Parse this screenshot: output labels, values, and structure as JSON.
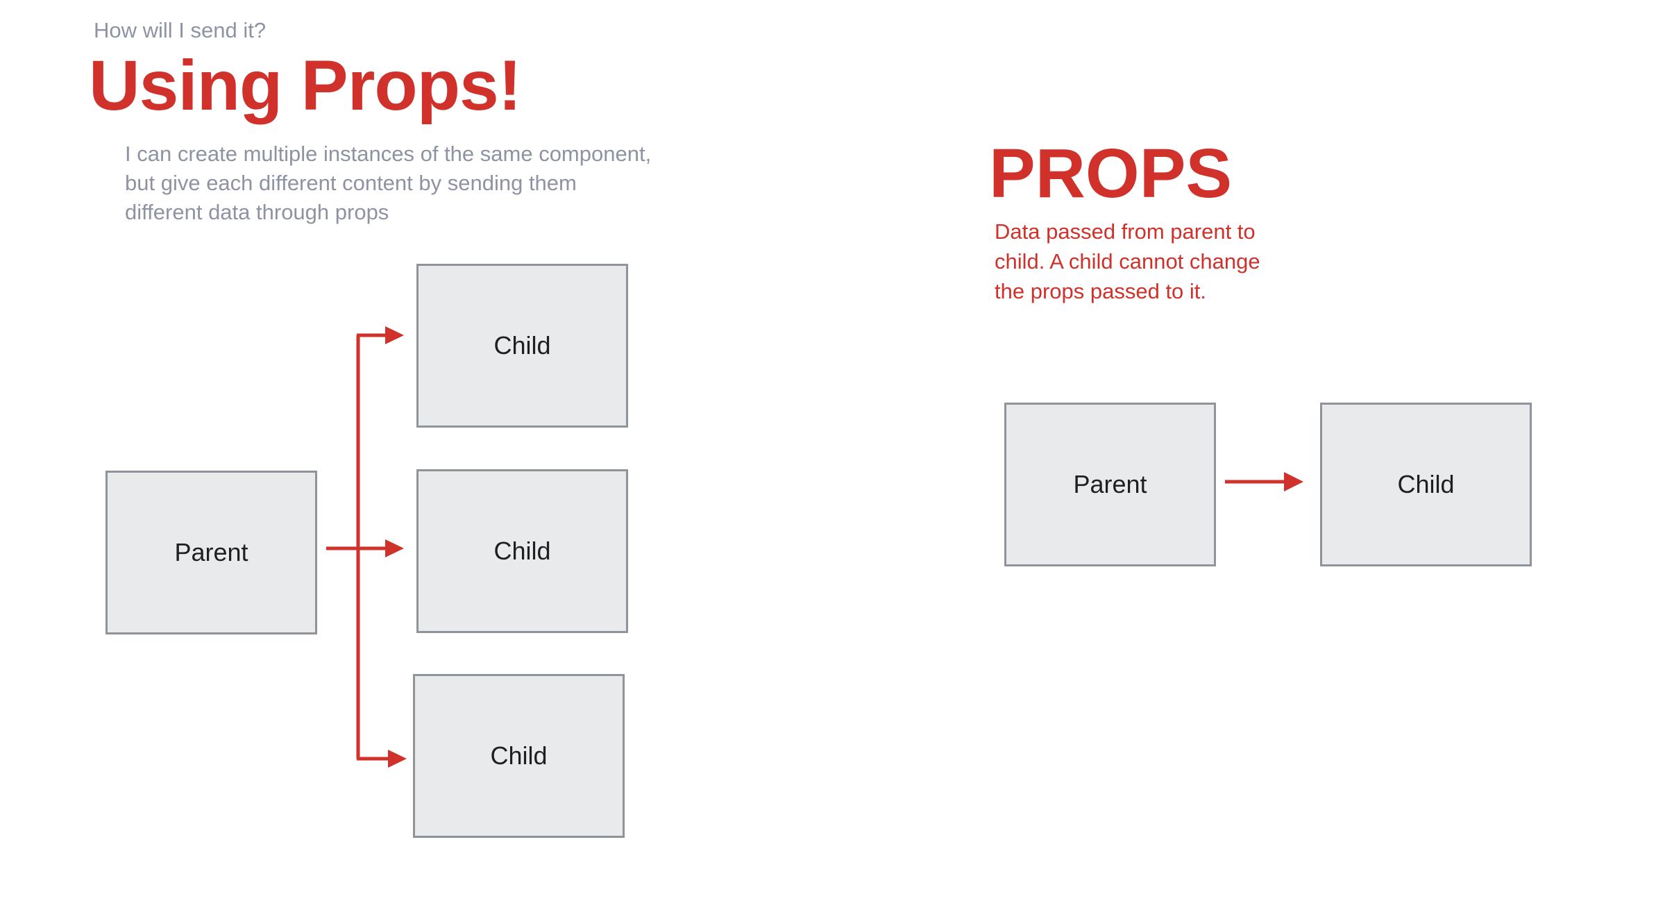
{
  "header": {
    "eyebrow": "How will I send it?",
    "title": "Using Props!",
    "description": "I can create multiple instances of the same component, but give each different content by sending them different data through props"
  },
  "left_diagram": {
    "parent_label": "Parent",
    "children": [
      {
        "label": "Child"
      },
      {
        "label": "Child"
      },
      {
        "label": "Child"
      }
    ]
  },
  "right_panel": {
    "title": "PROPS",
    "description": "Data passed from parent to child.  A child cannot change the props passed to it.",
    "parent_label": "Parent",
    "child_label": "Child"
  },
  "colors": {
    "accent": "#d0312a",
    "muted_text": "#8e93a3",
    "box_fill": "#e9eaec",
    "box_border": "#8f939a"
  }
}
